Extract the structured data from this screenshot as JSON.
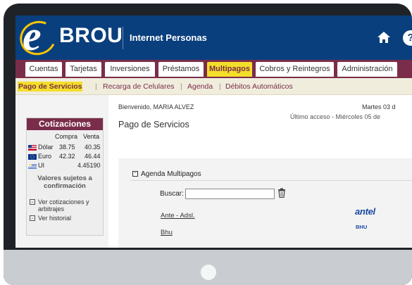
{
  "header": {
    "logo_letter": "e",
    "logo_brand": "BROU",
    "title": "Internet Personas",
    "help_glyph": "?"
  },
  "nav": {
    "tabs": [
      {
        "label": "Cuentas"
      },
      {
        "label": "Tarjetas"
      },
      {
        "label": "Inversiones"
      },
      {
        "label": "Préstamos"
      },
      {
        "label": "Multipagos",
        "active": true
      },
      {
        "label": "Cobros y Reintegros"
      },
      {
        "label": "Administración"
      }
    ]
  },
  "subnav": {
    "items": [
      {
        "label": "Pago de Servicios",
        "active": true
      },
      {
        "label": "Recarga de Celulares"
      },
      {
        "label": "Agenda"
      },
      {
        "label": "Débitos Automáticos"
      }
    ],
    "separator": "|"
  },
  "quotes": {
    "title": "Cotizaciones",
    "col_buy": "Compra",
    "col_sell": "Venta",
    "rows": [
      {
        "name": "Dólar",
        "buy": "38.75",
        "sell": "40.35",
        "flag": "us-flag-icon"
      },
      {
        "name": "Euro",
        "buy": "42.32",
        "sell": "46.44",
        "flag": "eu-flag-icon"
      },
      {
        "name": "UI",
        "buy": "",
        "sell": "4.45190",
        "flag": "uy-flag-icon"
      }
    ],
    "note": "Valores sujetos a confirmación",
    "links": [
      {
        "label": "Ver cotizaciones y arbitrajes"
      },
      {
        "label": "Ver historial"
      }
    ]
  },
  "main": {
    "welcome": "Bienvenido, MARIA  ALVEZ",
    "date": "Martes 03 d",
    "last_access": "Último acceso - Miércoles 05 de",
    "heading": "Pago de Servicios",
    "panel_title": "Agenda Multipagos",
    "search_label": "Buscar:",
    "search_value": "",
    "services": [
      {
        "label": "Ante - Adsl.",
        "logo_text": "antel"
      },
      {
        "label": "Bhu",
        "logo_text": "BHU"
      }
    ]
  },
  "colors": {
    "brand_blue": "#0a3f7e",
    "tab_bar": "#7a2d4a",
    "highlight": "#f3df2a",
    "subnav_bg": "#f0eddd"
  }
}
